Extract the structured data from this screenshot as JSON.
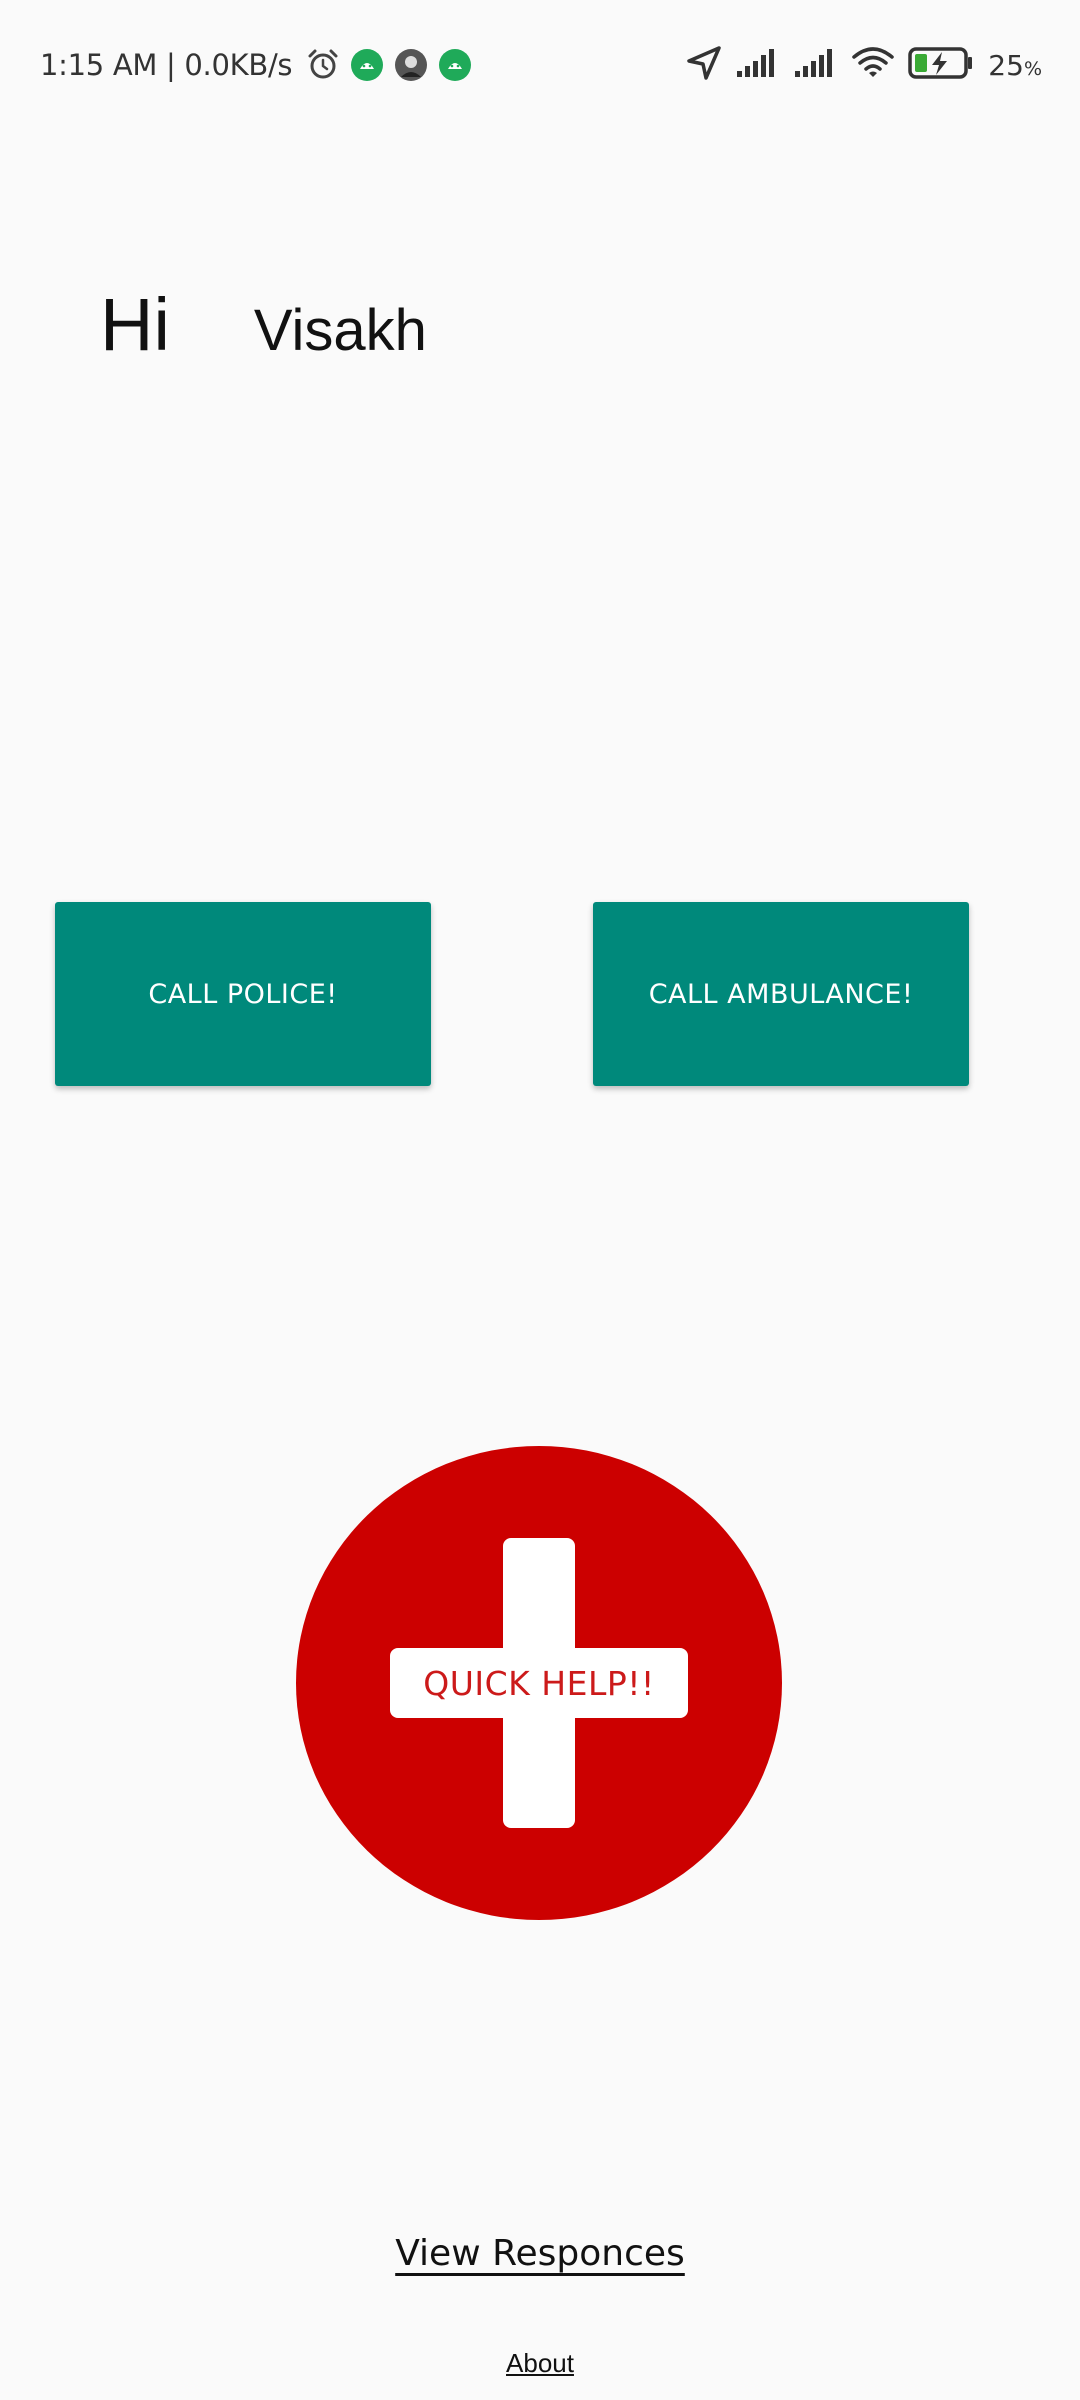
{
  "status_bar": {
    "time_and_speed": "1:15 AM | 0.0KB/s",
    "battery_percent": "25",
    "battery_unit": "%",
    "icons": [
      "alarm-icon",
      "android-notification-icon",
      "avatar-notification-icon",
      "android-notification-icon",
      "location-icon",
      "signal-icon",
      "signal-icon",
      "wifi-icon",
      "battery-charging-icon"
    ]
  },
  "greeting": {
    "hi": "Hi",
    "name": "Visakh"
  },
  "buttons": {
    "call_police": "CALL POLICE!",
    "call_ambulance": "CALL AMBULANCE!",
    "quick_help": "QUICK HELP!!"
  },
  "links": {
    "view_responses": "View Responces",
    "about": "About"
  },
  "colors": {
    "background": "#fafafa",
    "call_button": "#00897b",
    "quick_help": "#cc0000"
  }
}
